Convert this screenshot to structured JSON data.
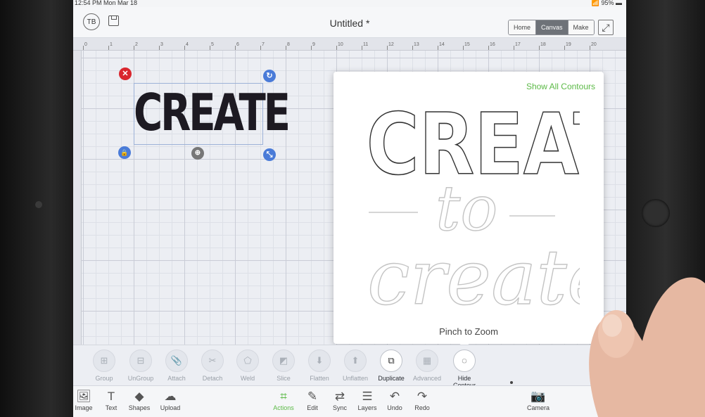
{
  "status_bar": {
    "time": "12:54 PM  Mon Mar 18",
    "battery": "95%"
  },
  "top_bar": {
    "avatar": "TB",
    "title": "Untitled *",
    "modes": [
      {
        "label": "Home",
        "active": false
      },
      {
        "label": "Canvas",
        "active": true
      },
      {
        "label": "Make",
        "active": false
      }
    ]
  },
  "ruler": {
    "ticks": [
      "0",
      "1",
      "2",
      "3",
      "4",
      "5",
      "6",
      "7",
      "8",
      "9",
      "10",
      "11",
      "12",
      "13",
      "14",
      "15",
      "16",
      "17",
      "18",
      "19",
      "20"
    ]
  },
  "canvas": {
    "selected_text": "CREATE"
  },
  "contour_panel": {
    "show_all_label": "Show All Contours",
    "hint": "Pinch to Zoom",
    "preview_lines": [
      "CREATED",
      "to",
      "create"
    ]
  },
  "actions": [
    {
      "label": "Group",
      "icon": "group-icon",
      "enabled": false
    },
    {
      "label": "UnGroup",
      "icon": "ungroup-icon",
      "enabled": false
    },
    {
      "label": "Attach",
      "icon": "attach-icon",
      "enabled": false
    },
    {
      "label": "Detach",
      "icon": "detach-icon",
      "enabled": false
    },
    {
      "label": "Weld",
      "icon": "weld-icon",
      "enabled": false
    },
    {
      "label": "Slice",
      "icon": "slice-icon",
      "enabled": false
    },
    {
      "label": "Flatten",
      "icon": "flatten-icon",
      "enabled": false
    },
    {
      "label": "Unflatten",
      "icon": "unflatten-icon",
      "enabled": false
    },
    {
      "label": "Duplicate",
      "icon": "duplicate-icon",
      "enabled": true
    },
    {
      "label": "Advanced",
      "icon": "advanced-icon",
      "enabled": false
    },
    {
      "label": "Hide Contour",
      "icon": "hide-contour-icon",
      "enabled": true
    }
  ],
  "bottom_bar": [
    {
      "label": "Image",
      "icon": "image-icon"
    },
    {
      "label": "Text",
      "icon": "text-icon"
    },
    {
      "label": "Shapes",
      "icon": "shapes-icon"
    },
    {
      "label": "Upload",
      "icon": "upload-icon"
    },
    {
      "label": "Actions",
      "icon": "actions-icon",
      "active": true
    },
    {
      "label": "Edit",
      "icon": "edit-icon"
    },
    {
      "label": "Sync",
      "icon": "sync-icon"
    },
    {
      "label": "Layers",
      "icon": "layers-icon"
    },
    {
      "label": "Undo",
      "icon": "undo-icon"
    },
    {
      "label": "Redo",
      "icon": "redo-icon"
    },
    {
      "label": "Camera",
      "icon": "camera-icon"
    }
  ],
  "colors": {
    "accent": "#5cba47",
    "handle_blue": "#4a7bd8",
    "delete_red": "#d9262e"
  }
}
